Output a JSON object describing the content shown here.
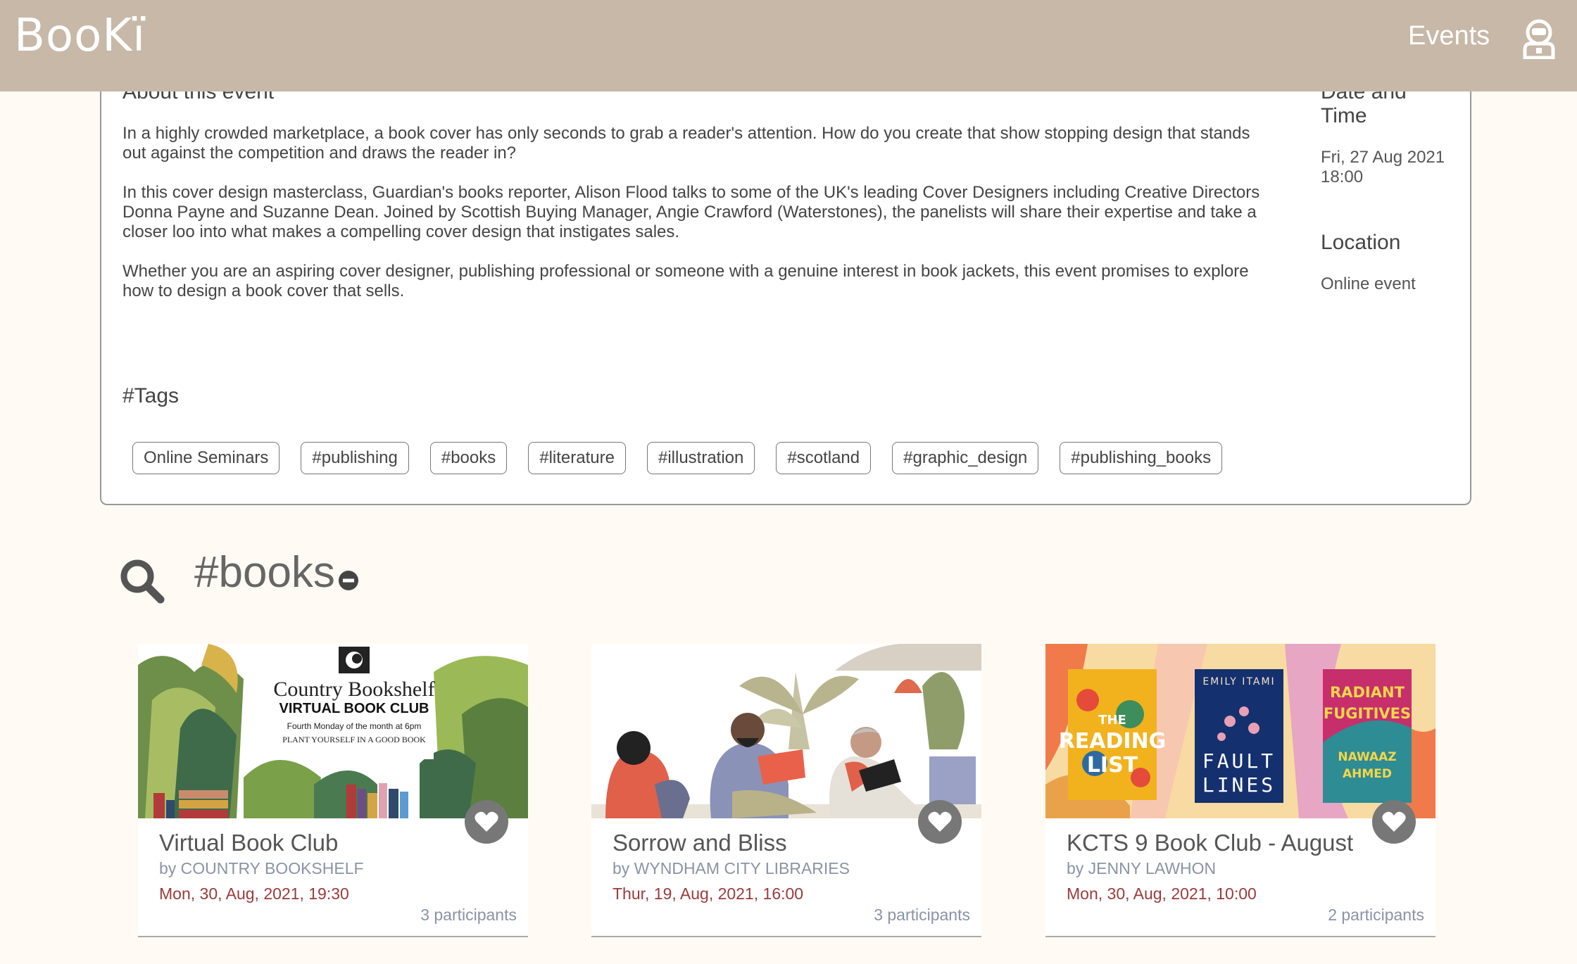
{
  "header": {
    "logo": "BooKï",
    "nav_events": "Events"
  },
  "event": {
    "about_title": "About this event",
    "paragraphs": [
      "In a highly crowded marketplace, a book cover has only seconds to grab a reader's attention. How do you create that show stopping design that stands out against the competition and draws the reader in?",
      "In this cover design masterclass, Guardian's books reporter, Alison Flood talks to some of the UK's leading Cover Designers including Creative Directors Donna Payne and Suzanne Dean. Joined by Scottish Buying Manager, Angie Crawford (Waterstones), the panelists will share their expertise and take a closer loo into what makes a compelling cover design that instigates sales.",
      "Whether you are an aspiring cover designer, publishing professional or someone with a genuine interest in book jackets, this event promises to explore how to design a book cover that sells."
    ],
    "date_title": "Date and Time",
    "date_line1": "Fri, 27 Aug 2021",
    "date_line2": "18:00",
    "location_title": "Location",
    "location_value": "Online event",
    "tags_title": "#Tags",
    "tags": [
      "Online Seminars",
      "#publishing",
      "#books",
      "#literature",
      "#illustration",
      "#scotland",
      "#graphic_design",
      "#publishing_books"
    ]
  },
  "search": {
    "term": "#books"
  },
  "cards": [
    {
      "title": "Virtual Book Club",
      "organizer": "by COUNTRY BOOKSHELF",
      "date": "Mon, 30, Aug, 2021, 19:30",
      "participants": "3 participants",
      "image_text": {
        "line1": "Country Bookshelf",
        "line2": "VIRTUAL BOOK CLUB",
        "line3": "Fourth Monday of the month at 6pm",
        "line4": "PLANT YOURSELF IN A GOOD BOOK"
      }
    },
    {
      "title": "Sorrow and Bliss",
      "organizer": "by WYNDHAM CITY LIBRARIES",
      "date": "Thur, 19, Aug, 2021, 16:00",
      "participants": "3 participants"
    },
    {
      "title": "KCTS 9 Book Club - August",
      "organizer": "by JENNY LAWHON",
      "date": "Mon, 30, Aug, 2021, 10:00",
      "participants": "2 participants",
      "image_text": {
        "book1_l1": "THE",
        "book1_l2": "READING",
        "book1_l3": "LIST",
        "book2_author": "EMILY ITAMI",
        "book2_l1": "FAULT",
        "book2_l2": "LINES",
        "book3_l1": "RADIANT",
        "book3_l2": "FUGITIVES",
        "book3_l3": "NAWAAZ",
        "book3_l4": "AHMED"
      }
    }
  ],
  "colors": {
    "header": "#c7b8a8",
    "background": "#fffaf4",
    "date": "#9a3b3b",
    "organizer": "#8a93a6"
  }
}
